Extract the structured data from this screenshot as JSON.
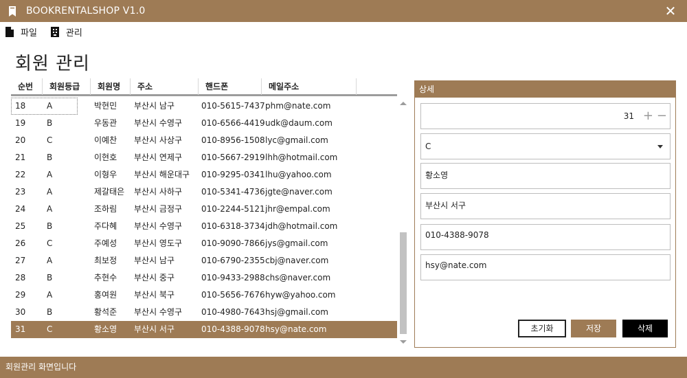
{
  "window": {
    "title": "BOOKRENTALSHOP V1.0",
    "close_glyph": "✕"
  },
  "menu": {
    "items": [
      {
        "label": "파일",
        "icon": "file-icon"
      },
      {
        "label": "관리",
        "icon": "manage-icon"
      }
    ]
  },
  "page": {
    "title": "회원 관리"
  },
  "grid": {
    "columns": [
      "순번",
      "회원등급",
      "회원명",
      "주소",
      "핸드폰",
      "메일주소"
    ],
    "rows": [
      [
        "18",
        "A",
        "박현민",
        "부산시 남구",
        "010-5615-7437",
        "phm@nate.com"
      ],
      [
        "19",
        "B",
        "우동관",
        "부산시 수영구",
        "010-6566-4419",
        "udk@daum.com"
      ],
      [
        "20",
        "C",
        "이예찬",
        "부산시 사상구",
        "010-8956-1508",
        "lyc@gmail.com"
      ],
      [
        "21",
        "B",
        "이현호",
        "부산시 연제구",
        "010-5667-2919",
        "lhh@hotmail.com"
      ],
      [
        "22",
        "A",
        "이형우",
        "부산시 해운대구",
        "010-9295-0341",
        "lhu@yahoo.com"
      ],
      [
        "23",
        "A",
        "제갈태은",
        "부산시 사하구",
        "010-5341-4736",
        "jgte@naver.com"
      ],
      [
        "24",
        "A",
        "조하림",
        "부산시 금정구",
        "010-2244-5121",
        "jhr@empal.com"
      ],
      [
        "25",
        "B",
        "주다혜",
        "부산시 수영구",
        "010-6318-3734",
        "jdh@hotmail.com"
      ],
      [
        "26",
        "C",
        "주예성",
        "부산시 영도구",
        "010-9090-7866",
        "jys@gmail.com"
      ],
      [
        "27",
        "A",
        "최보정",
        "부산시 남구",
        "010-6790-2355",
        "cbj@naver.com"
      ],
      [
        "28",
        "B",
        "추현수",
        "부산시 중구",
        "010-9433-2988",
        "chs@naver.com"
      ],
      [
        "29",
        "A",
        "홍여원",
        "부산시 북구",
        "010-5656-7676",
        "hyw@yahoo.com"
      ],
      [
        "30",
        "B",
        "황석준",
        "부산시 수영구",
        "010-4980-7643",
        "hsj@gmail.com"
      ],
      [
        "31",
        "C",
        "황소영",
        "부산시 서구",
        "010-4388-9078",
        "hsy@nate.com"
      ]
    ],
    "selected_index": 13,
    "focused_index": 0
  },
  "detail": {
    "header": "상세",
    "number": "31",
    "plus_glyph": "+",
    "minus_glyph": "−",
    "grade": "C",
    "name": "황소영",
    "address": "부산시 서구",
    "phone": "010-4388-9078",
    "email": "hsy@nate.com",
    "buttons": {
      "reset": "초기화",
      "save": "저장",
      "delete": "삭제"
    }
  },
  "status": {
    "text": "회원관리 화면입니다"
  },
  "colors": {
    "accent": "#9e7b55",
    "delete_bg": "#000000"
  }
}
